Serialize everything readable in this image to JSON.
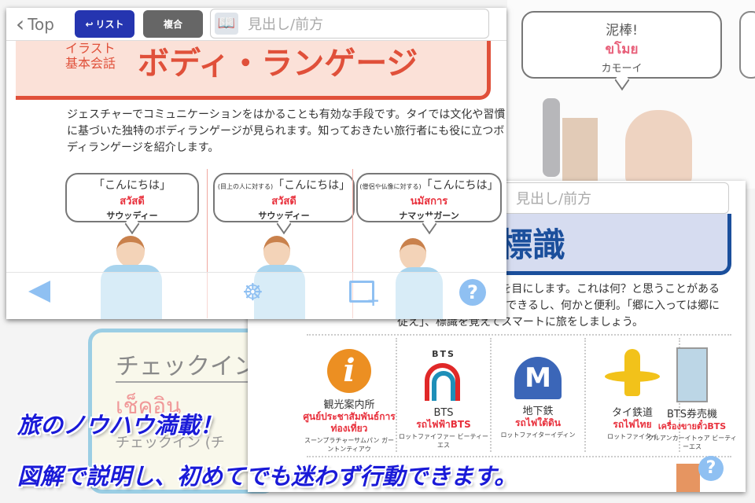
{
  "background_window": {
    "bubble_ja": "泥棒!",
    "bubble_th": "ขโมย",
    "bubble_reading": "カモーイ"
  },
  "checkin_card": {
    "title": "チェックイン",
    "thai": "เช็คอิน",
    "subtitle": "チェックイン (チ"
  },
  "front_window": {
    "header": {
      "back_label": "Top",
      "list_label": "リスト",
      "combined_label": "複合",
      "search_placeholder": "見出し/前方"
    },
    "banner": {
      "kicker_line1": "イラスト",
      "kicker_line2": "基本会話",
      "title": "ボディ・ランゲージ"
    },
    "intro": "ジェスチャーでコミュニケーションをはかることも有効な手段です。タイでは文化や習慣に基づいた独特のボディランゲージが見られます。知っておきたい旅行者にも役に立つボディランゲージを紹介します。",
    "panels": [
      {
        "note": "",
        "ja": "「こんにちは」",
        "th": "สวัสดี",
        "reading": "サウッディー"
      },
      {
        "note": "(目上の人に対する)",
        "ja": "「こんにちは」",
        "th": "สวัสดี",
        "reading": "サウッディー"
      },
      {
        "note": "(僧侶や仏像に対する)",
        "ja": "「こんにちは」",
        "th": "นมัสการ",
        "reading": "ナマッサガーン"
      }
    ],
    "toolbar": [
      "back-arrow-icon",
      "dharma-wheel-icon",
      "book-add-icon",
      "help-icon"
    ]
  },
  "second_window": {
    "search_placeholder": "見出し/前方",
    "title": "標識",
    "intro_lines": [
      "を目にします。これは何？と思うことがある",
      "できるし、何かと便利。「郷に入っては郷に",
      "従え」、標識を覚えてスマートに旅をしましょう。"
    ],
    "signs": [
      {
        "ja": "観光案内所",
        "th": "ศูนย์ประชาสัมพันธ์การท่องเที่ยว",
        "reading": "スーンプラチャーサムパン ガーントンティアウ"
      },
      {
        "ja": "BTS",
        "th": "รถไฟฟ้าBTS",
        "reading": "ロットファイファー ビーティーエス"
      },
      {
        "ja": "地下鉄",
        "th": "รถไฟใต้ดิน",
        "reading": "ロットファイターイディン"
      },
      {
        "ja": "タイ鉄道",
        "th": "รถไฟไทย",
        "reading": "ロットファイタイ"
      },
      {
        "ja": "BTS券売機",
        "th": "เครื่องขายตั๋วBTS",
        "reading": "クルアンカーイトゥア ビーティーエス"
      }
    ]
  },
  "caption": {
    "line1": "旅のノウハウ満載！",
    "line2": "図解で説明し、初めてでも迷わず行動できます。"
  },
  "colors": {
    "accent_red": "#e0503a",
    "banner_pink": "#fbe1d8",
    "list_blue": "#2535b0",
    "caption_blue": "#1a1ad8",
    "sign_blue": "#1b4f9c"
  }
}
